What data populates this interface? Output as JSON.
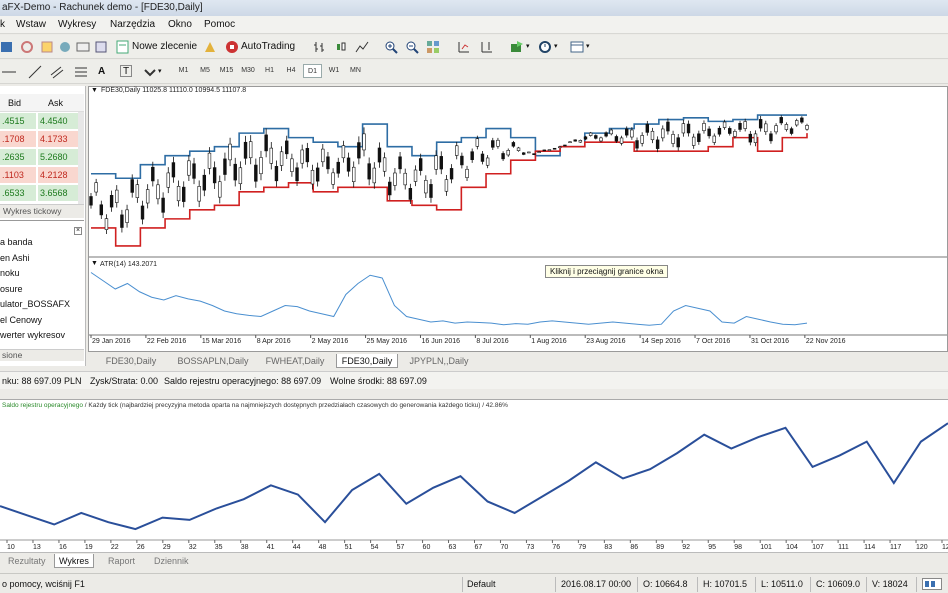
{
  "window": {
    "title": "aFX-Demo - Rachunek demo - [FDE30,Daily]"
  },
  "menu": [
    "k",
    "Wstaw",
    "Wykresy",
    "Narzędzia",
    "Okno",
    "Pomoc"
  ],
  "toolbar1": {
    "new_order": "Nowe zlecenie",
    "autotrading": "AutoTrading"
  },
  "timeframes": [
    "M1",
    "M5",
    "M15",
    "M30",
    "H1",
    "H4",
    "D1",
    "W1",
    "MN"
  ],
  "timeframe_selected": "D1",
  "toolbar2_extra": {
    "text_tool": "A",
    "label_tool": "T"
  },
  "market_watch": {
    "headers": {
      "bid": "Bid",
      "ask": "Ask"
    },
    "rows": [
      {
        "bid": ".4515",
        "ask": "4.4540"
      },
      {
        "bid": ".1708",
        "ask": "4.1733"
      },
      {
        "bid": ".2635",
        "ask": "5.2680"
      },
      {
        "bid": ".1103",
        "ask": "4.2128"
      },
      {
        "bid": ".6533",
        "ask": "3.6568"
      }
    ],
    "tick_tab": "Wykres tickowy"
  },
  "navigator": {
    "items": [
      "a banda",
      "en Ashi",
      "noku",
      "osure",
      "ulator_BOSSAFX",
      "el Cenowy",
      "werter wykresov"
    ],
    "tab": "sione"
  },
  "chart": {
    "header": "FDE30,Daily  11025.8 11110.0 10994.5 11107.8",
    "indicator_label": "ATR(14) 143.2071",
    "tooltip": "Kliknij i przeciągnij granice okna",
    "date_labels": [
      "29 Jan 2016",
      "22 Feb 2016",
      "15 Mar 2016",
      "8 Apr 2016",
      "2 May 2016",
      "25 May 2016",
      "16 Jun 2016",
      "8 Jul 2016",
      "1 Aug 2016",
      "23 Aug 2016",
      "14 Sep 2016",
      "7 Oct 2016",
      "31 Oct 2016",
      "22 Nov 2016"
    ],
    "colors": {
      "band_upper": "#2e6da4",
      "band_lower": "#d02020",
      "atr": "#4a8fd0"
    }
  },
  "chart_tabs": [
    "FDE30,Daily",
    "BOSSAPLN,Daily",
    "FWHEAT,Daily",
    "FDE30,Daily",
    "JPYPLN,,Daily"
  ],
  "chart_tab_selected": 3,
  "account_bar": {
    "balance": "nku: 88 697.09 PLN",
    "profit": "Zysk/Strata: 0.00",
    "register": "Saldo rejestru operacyjnego: 88 697.09",
    "free": "Wolne środki: 88 697.09"
  },
  "tester": {
    "legend_label": "Saldo rejestru operacyjnego",
    "legend_rest": " / Każdy tick (najbardziej precyzyjna metoda oparta na najmniejszych dostępnych przedziałach czasowych do generowania każdego ticku) / 42.86%",
    "x_labels": [
      "10",
      "13",
      "16",
      "19",
      "22",
      "26",
      "29",
      "32",
      "35",
      "38",
      "41",
      "44",
      "48",
      "51",
      "54",
      "57",
      "60",
      "63",
      "67",
      "70",
      "73",
      "76",
      "79",
      "83",
      "86",
      "89",
      "92",
      "95",
      "98",
      "101",
      "104",
      "107",
      "111",
      "114",
      "117",
      "120",
      "12"
    ],
    "line_color": "#2a4f9a"
  },
  "bottom_tabs": [
    "Rezultaty",
    "Wykres",
    "Raport",
    "Dziennik"
  ],
  "bottom_tab_selected": 1,
  "statusbar": {
    "help": "o pomocy, wciśnij F1",
    "profile": "Default",
    "datetime": "2016.08.17 00:00",
    "open": "O: 10664.8",
    "high": "H: 10701.5",
    "low": "L: 10511.0",
    "close": "C: 10609.0",
    "volume": "V: 18024"
  },
  "chart_data": [
    {
      "type": "line",
      "title": "FDE30,Daily",
      "x_range": [
        "29 Jan 2016",
        "30 Nov 2016"
      ],
      "series": [
        {
          "name": "",
          "color": "#2e6da4",
          "values": [
            10300,
            10250,
            10400,
            10500,
            10550,
            10600,
            10750,
            10800,
            10700,
            10650,
            10600,
            10850,
            10600,
            10500,
            10650,
            10700,
            10800,
            10700,
            10500,
            10600,
            10750,
            10800,
            10850,
            10900,
            10920,
            10880,
            10900,
            10950,
            10950,
            10950
          ]
        },
        {
          "name": "",
          "color": "#d02020",
          "values": [
            9700,
            9500,
            9700,
            9800,
            9900,
            9950,
            10100,
            10150,
            10200,
            10100,
            10150,
            10150,
            10000,
            9950,
            9900,
            10150,
            10300,
            10450,
            10550,
            10600,
            10650,
            10650,
            10550,
            10550,
            10550,
            10600,
            10700,
            10550,
            10700,
            10750
          ]
        }
      ]
    },
    {
      "type": "line",
      "title": "",
      "x_range": [
        "1",
        "122"
      ],
      "series": [
        {
          "name": "Saldo rejestru operacyjnego",
          "values": [
            88200,
            87800,
            87400,
            87900,
            87500,
            87200,
            87700,
            87600,
            88100,
            88500,
            89100,
            88700,
            87500,
            88900,
            89600,
            88300,
            89000,
            89500,
            88400,
            87900,
            88600,
            89300,
            90100,
            89400,
            89800,
            90500,
            91300,
            90700,
            91200,
            91600,
            89900,
            90400,
            91000,
            89200,
            91000,
            91800
          ]
        }
      ]
    }
  ]
}
